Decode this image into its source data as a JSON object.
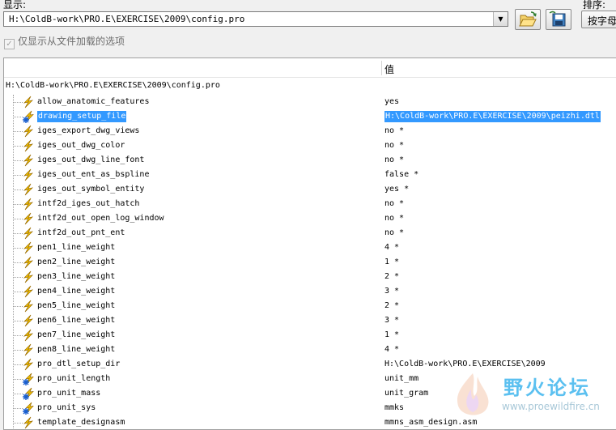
{
  "top": {
    "show_label": "显示:",
    "path_value": "H:\\ColdB-work\\PRO.E\\EXERCISE\\2009\\config.pro",
    "sort_label": "排序:",
    "sort_value": "按字母"
  },
  "filter": {
    "only_loaded_label": "仅显示从文件加载的选项",
    "checked": true
  },
  "table": {
    "value_header": "值",
    "root": "H:\\ColdB-work\\PRO.E\\EXERCISE\\2009\\config.pro",
    "rows": [
      {
        "name": "allow_anatomic_features",
        "value": "yes",
        "icon": "lightning-icon"
      },
      {
        "name": "drawing_setup_file",
        "value": "H:\\ColdB-work\\PRO.E\\EXERCISE\\2009\\peizhi.dtl",
        "icon": "star-lightning-icon",
        "selected": true
      },
      {
        "name": "iges_export_dwg_views",
        "value": "no *",
        "icon": "lightning-icon"
      },
      {
        "name": "iges_out_dwg_color",
        "value": "no *",
        "icon": "lightning-icon"
      },
      {
        "name": "iges_out_dwg_line_font",
        "value": "no *",
        "icon": "lightning-icon"
      },
      {
        "name": "iges_out_ent_as_bspline",
        "value": "false *",
        "icon": "lightning-icon"
      },
      {
        "name": "iges_out_symbol_entity",
        "value": "yes *",
        "icon": "lightning-icon"
      },
      {
        "name": "intf2d_iges_out_hatch",
        "value": "no *",
        "icon": "lightning-icon"
      },
      {
        "name": "intf2d_out_open_log_window",
        "value": "no *",
        "icon": "lightning-icon"
      },
      {
        "name": "intf2d_out_pnt_ent",
        "value": "no *",
        "icon": "lightning-icon"
      },
      {
        "name": "pen1_line_weight",
        "value": "4 *",
        "icon": "lightning-icon"
      },
      {
        "name": "pen2_line_weight",
        "value": "1 *",
        "icon": "lightning-icon"
      },
      {
        "name": "pen3_line_weight",
        "value": "2 *",
        "icon": "lightning-icon"
      },
      {
        "name": "pen4_line_weight",
        "value": "3 *",
        "icon": "lightning-icon"
      },
      {
        "name": "pen5_line_weight",
        "value": "2 *",
        "icon": "lightning-icon"
      },
      {
        "name": "pen6_line_weight",
        "value": "3 *",
        "icon": "lightning-icon"
      },
      {
        "name": "pen7_line_weight",
        "value": "1 *",
        "icon": "lightning-icon"
      },
      {
        "name": "pen8_line_weight",
        "value": "4 *",
        "icon": "lightning-icon"
      },
      {
        "name": "pro_dtl_setup_dir",
        "value": "H:\\ColdB-work\\PRO.E\\EXERCISE\\2009",
        "icon": "lightning-icon"
      },
      {
        "name": "pro_unit_length",
        "value": "unit_mm",
        "icon": "star-lightning-icon"
      },
      {
        "name": "pro_unit_mass",
        "value": "unit_gram",
        "icon": "star-lightning-icon"
      },
      {
        "name": "pro_unit_sys",
        "value": "mmks",
        "icon": "star-lightning-icon"
      },
      {
        "name": "template_designasm",
        "value": "mmns_asm_design.asm",
        "icon": "lightning-icon"
      }
    ]
  },
  "watermark": {
    "title": "野火论坛",
    "url": "www.proewildfire.cn"
  },
  "colors": {
    "selection": "#3399ff",
    "lightning": "#f2c200",
    "star": "#1a5fd0"
  }
}
